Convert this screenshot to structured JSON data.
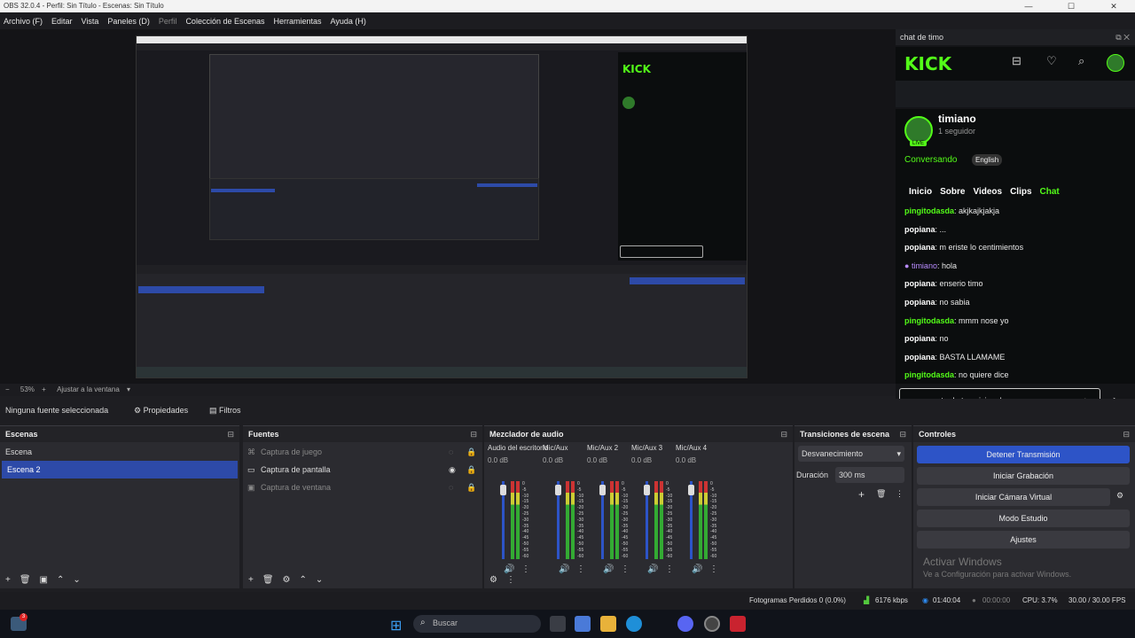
{
  "window": {
    "title": "OBS 32.0.4 - Perfil: Sin Título - Escenas: Sin Título"
  },
  "menu": [
    "Archivo (F)",
    "Editar",
    "Vista",
    "Paneles (D)",
    "Perfil",
    "Colección de Escenas",
    "Herramientas",
    "Ayuda (H)"
  ],
  "chat_dock": {
    "title": "chat de timo",
    "brand": "KICK",
    "channel": "timiano",
    "followers": "1 seguidor",
    "live_badge": "LIVE",
    "status": "Conversando",
    "language": "English",
    "tabs": [
      "Inicio",
      "Sobre",
      "Videos",
      "Clips",
      "Chat"
    ],
    "active_tab": "Chat",
    "messages": [
      {
        "user": "pingitodasda",
        "text": "akjkajkjakja",
        "style": "green"
      },
      {
        "user": "popiana",
        "text": "...",
        "style": "white"
      },
      {
        "user": "popiana",
        "text": "m eriste lo centimientos",
        "style": "white"
      },
      {
        "user": "timiano",
        "text": "hola",
        "style": "purple"
      },
      {
        "user": "popiana",
        "text": "enserio timo",
        "style": "white"
      },
      {
        "user": "popiana",
        "text": "no sabia",
        "style": "white"
      },
      {
        "user": "pingitodasda",
        "text": "mmm nose yo",
        "style": "green"
      },
      {
        "user": "popiana",
        "text": "no",
        "style": "white"
      },
      {
        "user": "popiana",
        "text": "BASTA LLAMAME",
        "style": "white"
      },
      {
        "user": "pingitodasda",
        "text": "no quiere dice",
        "style": "green"
      }
    ],
    "input_value": "corte de transicion..|"
  },
  "preview": {
    "zoom": "53%",
    "fit_label": "Ajustar a la ventana"
  },
  "source_bar": {
    "no_source": "Ninguna fuente seleccionada",
    "properties": "Propiedades",
    "filters": "Filtros"
  },
  "scenes": {
    "title": "Escenas",
    "items": [
      "Escena",
      "Escena 2"
    ],
    "selected": "Escena 2"
  },
  "sources": {
    "title": "Fuentes",
    "items": [
      {
        "label": "Captura de juego",
        "active": false
      },
      {
        "label": "Captura de pantalla",
        "active": true
      },
      {
        "label": "Captura de ventana",
        "active": false
      }
    ]
  },
  "mixer": {
    "title": "Mezclador de audio",
    "channels": [
      {
        "name": "Audio del escritorio",
        "db": "0.0 dB"
      },
      {
        "name": "Mic/Aux",
        "db": "0.0 dB"
      },
      {
        "name": "Mic/Aux 2",
        "db": "0.0 dB"
      },
      {
        "name": "Mic/Aux 3",
        "db": "0.0 dB"
      },
      {
        "name": "Mic/Aux 4",
        "db": "0.0 dB"
      }
    ],
    "scale": [
      "0",
      "-5",
      "-10",
      "-15",
      "-20",
      "-25",
      "-30",
      "-35",
      "-40",
      "-45",
      "-50",
      "-55",
      "-60"
    ]
  },
  "transitions": {
    "title": "Transiciones de escena",
    "selected": "Desvanecimiento",
    "duration_label": "Duración",
    "duration_value": "300 ms"
  },
  "controls": {
    "title": "Controles",
    "buttons": [
      "Detener Transmisión",
      "Iniciar Grabación",
      "Iniciar Cámara Virtual",
      "Modo Estudio",
      "Ajustes"
    ]
  },
  "watermark": {
    "line1": "Activar Windows",
    "line2": "Ve a Configuración para activar Windows."
  },
  "statusbar": {
    "dropped": "Fotogramas Perdidos 0 (0.0%)",
    "bitrate": "6176 kbps",
    "stream_time": "01:40:04",
    "rec_time": "00:00:00",
    "cpu": "CPU: 3.7%",
    "fps": "30.00 / 30.00 FPS"
  },
  "taskbar": {
    "search_placeholder": "Buscar",
    "notification_count": "3"
  }
}
